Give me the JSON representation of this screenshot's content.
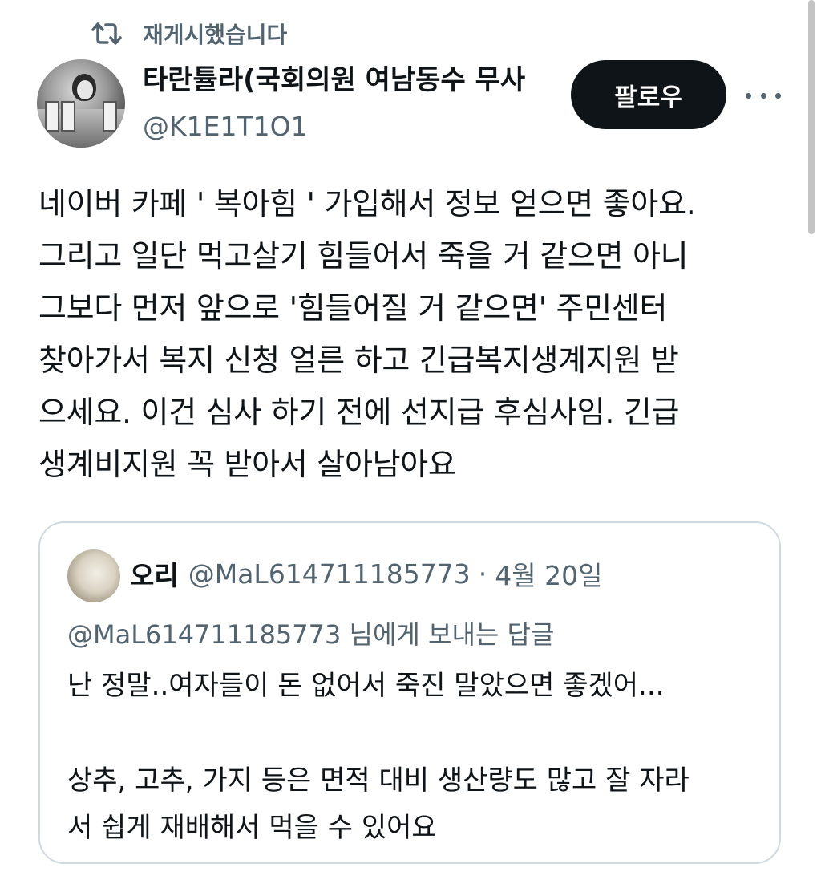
{
  "retweet": {
    "icon": "retweet-icon",
    "label": "재게시했습니다"
  },
  "author": {
    "display_name": "타란튤라(국회의원 여남동수 무사",
    "handle": "@K1E1T1O1"
  },
  "actions": {
    "follow_label": "팔로우",
    "more_icon": "more-horizontal-icon"
  },
  "tweet": {
    "text": "네이버 카페 ' 복아힘 ' 가입해서 정보 얻으면 좋아요.\n그리고 일단 먹고살기 힘들어서 죽을 거 같으면 아니\n그보다 먼저 앞으로 '힘들어질 거 같으면' 주민센터\n찾아가서 복지 신청 얼른 하고 긴급복지생계지원 받\n으세요. 이건 심사 하기 전에 선지급 후심사임. 긴급\n생계비지원 꼭 받아서 살아남아요"
  },
  "quote": {
    "name": "오리",
    "handle": "@MaL614711185773",
    "separator": "·",
    "date": "4월 20일",
    "reply_to": "@MaL614711185773 님에게 보내는 답글",
    "body": "난 정말..여자들이 돈 없어서 죽진 말았으면 좋겠어...\n\n상추, 고추, 가지 등은 면적 대비 생산량도 많고 잘 자라\n서 쉽게 재배해서 먹을 수 있어요"
  },
  "colors": {
    "text_primary": "#0f1419",
    "text_secondary": "#536471",
    "button_bg": "#0f1419",
    "border": "#cfd9de"
  }
}
